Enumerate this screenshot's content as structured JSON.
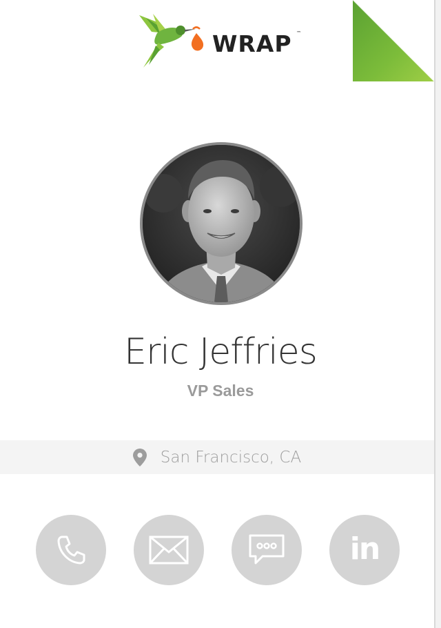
{
  "brand": {
    "logo_text": "WRAP",
    "trademark": "™"
  },
  "profile": {
    "name": "Eric Jeffries",
    "title": "VP Sales",
    "location": "San Francisco, CA"
  },
  "actions": [
    {
      "icon": "phone-icon"
    },
    {
      "icon": "email-icon"
    },
    {
      "icon": "message-icon"
    },
    {
      "icon": "linkedin-icon",
      "label": "in"
    }
  ],
  "colors": {
    "brand_green": "#8dc63f",
    "brand_orange": "#f26f21",
    "action_bg": "#d4d4d4",
    "text_muted": "#9a9a9a"
  }
}
